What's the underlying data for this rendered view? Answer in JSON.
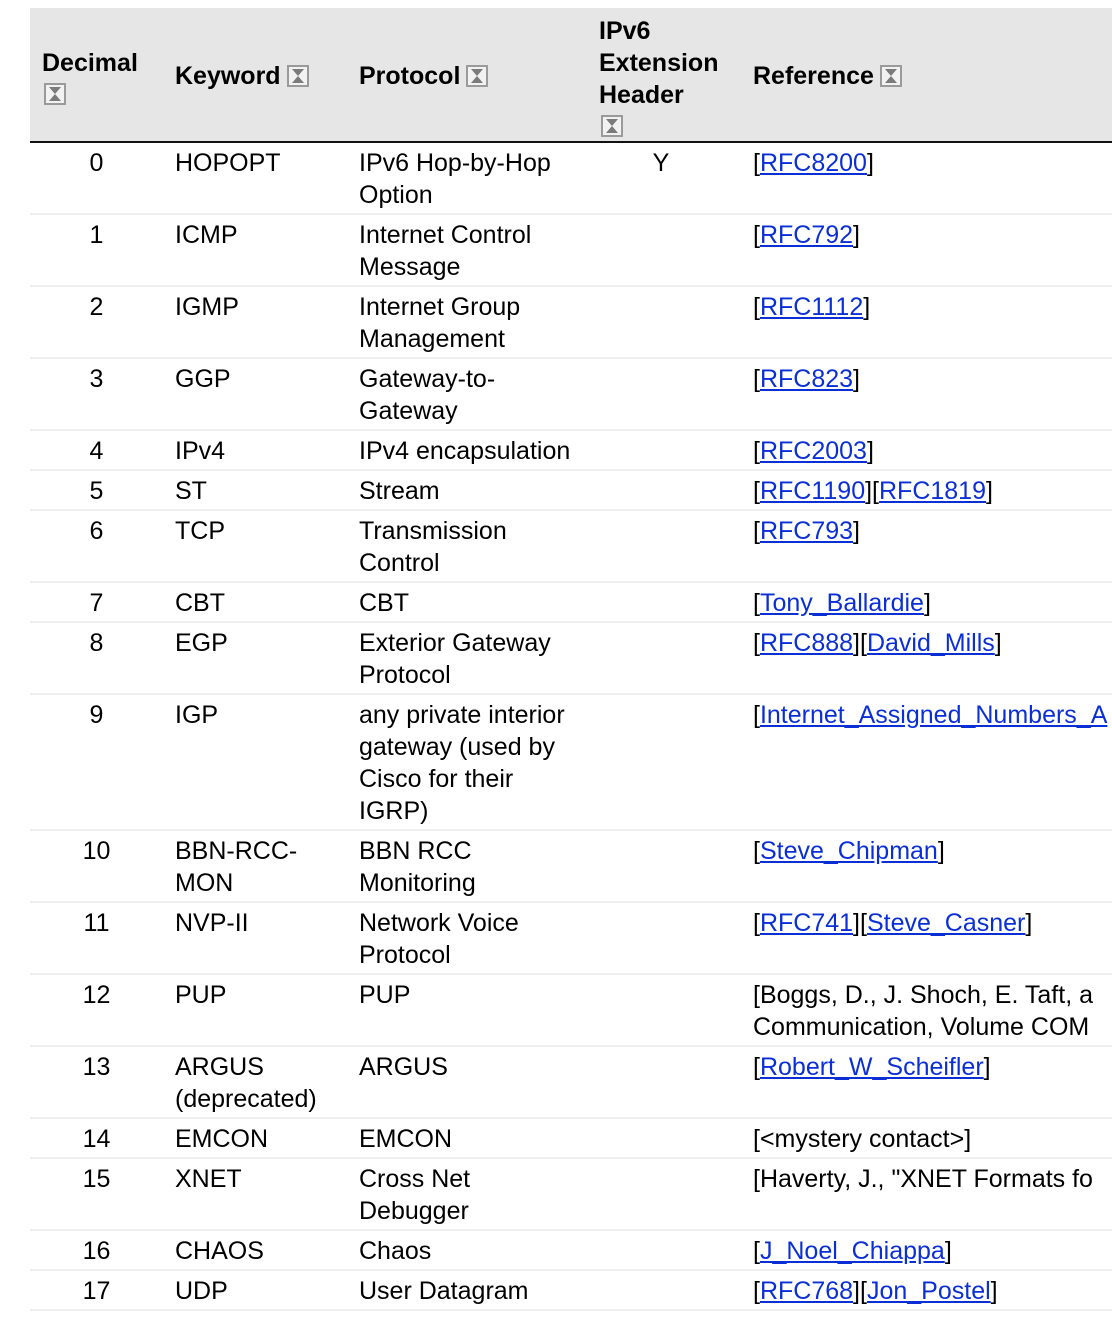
{
  "headers": {
    "decimal": "Decimal",
    "keyword": "Keyword",
    "protocol": "Protocol",
    "ipv6_ext_line1": "IPv6",
    "ipv6_ext_line2": "Extension",
    "ipv6_ext_line3": "Header",
    "reference": "Reference"
  },
  "icons": {
    "sort": "sort-icon"
  },
  "colors": {
    "header_bg": "#e6e6e6",
    "link": "#0b2fd6",
    "row_divider": "#eeeeee"
  },
  "rows": [
    {
      "decimal": "0",
      "keyword": "HOPOPT",
      "protocol": "IPv6 Hop-by-Hop Option",
      "ext": "Y",
      "ref": [
        {
          "t": "["
        },
        {
          "link": "RFC8200"
        },
        {
          "t": "]"
        }
      ]
    },
    {
      "decimal": "1",
      "keyword": "ICMP",
      "protocol": "Internet Control Message",
      "ext": "",
      "ref": [
        {
          "t": "["
        },
        {
          "link": "RFC792"
        },
        {
          "t": "]"
        }
      ]
    },
    {
      "decimal": "2",
      "keyword": "IGMP",
      "protocol": "Internet Group Management",
      "ext": "",
      "ref": [
        {
          "t": "["
        },
        {
          "link": "RFC1112"
        },
        {
          "t": "]"
        }
      ]
    },
    {
      "decimal": "3",
      "keyword": "GGP",
      "protocol": "Gateway-to-Gateway",
      "ext": "",
      "ref": [
        {
          "t": "["
        },
        {
          "link": "RFC823"
        },
        {
          "t": "]"
        }
      ]
    },
    {
      "decimal": "4",
      "keyword": "IPv4",
      "protocol": "IPv4 encapsulation",
      "ext": "",
      "ref": [
        {
          "t": "["
        },
        {
          "link": "RFC2003"
        },
        {
          "t": "]"
        }
      ]
    },
    {
      "decimal": "5",
      "keyword": "ST",
      "protocol": "Stream",
      "ext": "",
      "ref": [
        {
          "t": "["
        },
        {
          "link": "RFC1190"
        },
        {
          "t": "]["
        },
        {
          "link": "RFC1819"
        },
        {
          "t": "]"
        }
      ]
    },
    {
      "decimal": "6",
      "keyword": "TCP",
      "protocol": "Transmission Control",
      "ext": "",
      "ref": [
        {
          "t": "["
        },
        {
          "link": "RFC793"
        },
        {
          "t": "]"
        }
      ]
    },
    {
      "decimal": "7",
      "keyword": "CBT",
      "protocol": "CBT",
      "ext": "",
      "ref": [
        {
          "t": "["
        },
        {
          "link": "Tony_Ballardie"
        },
        {
          "t": "]"
        }
      ]
    },
    {
      "decimal": "8",
      "keyword": "EGP",
      "protocol": "Exterior Gateway Protocol",
      "ext": "",
      "ref": [
        {
          "t": "["
        },
        {
          "link": "RFC888"
        },
        {
          "t": "]["
        },
        {
          "link": "David_Mills"
        },
        {
          "t": "]"
        }
      ]
    },
    {
      "decimal": "9",
      "keyword": "IGP",
      "protocol": "any private interior gateway (used by Cisco for their IGRP)",
      "ext": "",
      "ref": [
        {
          "t": "["
        },
        {
          "link": "Internet_Assigned_Numbers_A"
        }
      ]
    },
    {
      "decimal": "10",
      "keyword": "BBN-RCC-MON",
      "protocol": "BBN RCC Monitoring",
      "ext": "",
      "ref": [
        {
          "t": "["
        },
        {
          "link": "Steve_Chipman"
        },
        {
          "t": "]"
        }
      ]
    },
    {
      "decimal": "11",
      "keyword": "NVP-II",
      "protocol": "Network Voice Protocol",
      "ext": "",
      "ref": [
        {
          "t": "["
        },
        {
          "link": "RFC741"
        },
        {
          "t": "]["
        },
        {
          "link": "Steve_Casner"
        },
        {
          "t": "]"
        }
      ]
    },
    {
      "decimal": "12",
      "keyword": "PUP",
      "protocol": "PUP",
      "ext": "",
      "ref_lines": [
        "[Boggs, D., J. Shoch, E. Taft, a",
        "Communication, Volume COM"
      ]
    },
    {
      "decimal": "13",
      "keyword": "ARGUS (deprecated)",
      "protocol": "ARGUS",
      "ext": "",
      "ref": [
        {
          "t": "["
        },
        {
          "link": "Robert_W_Scheifler"
        },
        {
          "t": "]"
        }
      ]
    },
    {
      "decimal": "14",
      "keyword": "EMCON",
      "protocol": "EMCON",
      "ext": "",
      "ref": [
        {
          "t": "[<mystery contact>]"
        }
      ]
    },
    {
      "decimal": "15",
      "keyword": "XNET",
      "protocol": "Cross Net Debugger",
      "ext": "",
      "ref": [
        {
          "t": "[Haverty, J., \"XNET Formats fo"
        }
      ]
    },
    {
      "decimal": "16",
      "keyword": "CHAOS",
      "protocol": "Chaos",
      "ext": "",
      "ref": [
        {
          "t": "["
        },
        {
          "link": "J_Noel_Chiappa"
        },
        {
          "t": "]"
        }
      ]
    },
    {
      "decimal": "17",
      "keyword": "UDP",
      "protocol": "User Datagram",
      "ext": "",
      "ref": [
        {
          "t": "["
        },
        {
          "link": "RFC768"
        },
        {
          "t": "]["
        },
        {
          "link": "Jon_Postel"
        },
        {
          "t": "]"
        }
      ]
    }
  ]
}
